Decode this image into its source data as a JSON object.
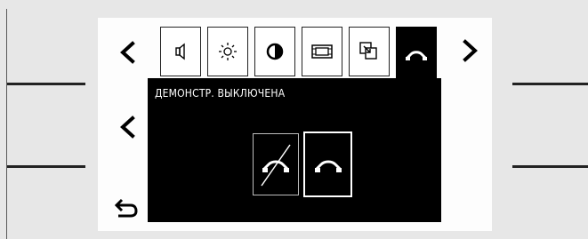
{
  "screen": {
    "message": "ДЕМОНСТР. ВЫКЛЮЧЕНА"
  },
  "nav": {
    "prev_tab": "chevron-left-icon",
    "next_tab": "chevron-right-icon",
    "prev_item": "chevron-left-icon",
    "back": "return-arrow-icon"
  },
  "tabs": [
    {
      "icon": "speaker-icon"
    },
    {
      "icon": "brightness-icon"
    },
    {
      "icon": "contrast-icon"
    },
    {
      "icon": "screen-frame-icon"
    },
    {
      "icon": "resize-window-icon"
    },
    {
      "icon": "demo-mode-icon",
      "active": true
    }
  ],
  "options": [
    {
      "icon": "demo-off-icon",
      "selected": false
    },
    {
      "icon": "demo-on-icon",
      "selected": true
    }
  ],
  "colors": {
    "panel": "#000000",
    "bezel": "#e7e7e7",
    "screen": "#fdfdfd"
  }
}
